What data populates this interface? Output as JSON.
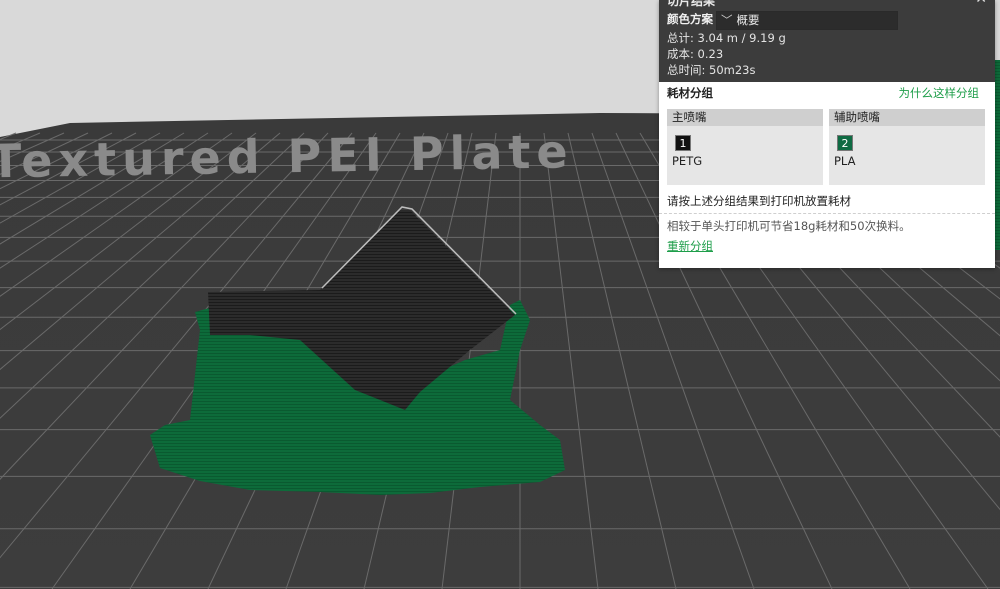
{
  "summary": {
    "title": "切片结果",
    "color_scheme_label": "颜色方案",
    "color_scheme_value": "概要",
    "total": "总计:  3.04 m / 9.19 g",
    "cost": "成本:  0.23",
    "time": "总时间:  50m23s"
  },
  "grouping": {
    "header": "耗材分组",
    "why_link": "为什么这样分组",
    "left_nozzle": {
      "title": "主喷嘴",
      "slot": "1",
      "material": "PETG",
      "color": "#111111"
    },
    "right_nozzle": {
      "title": "辅助喷嘴",
      "slot": "2",
      "material": "PLA",
      "color": "#0f6b43"
    },
    "instruction": "请按上述分组结果到打印机放置耗材",
    "savings": "相较于单头打印机可节省18g耗材和50次换料。",
    "regroup_link": "重新分组"
  },
  "plate": {
    "label": "Textured PEI Plate"
  }
}
